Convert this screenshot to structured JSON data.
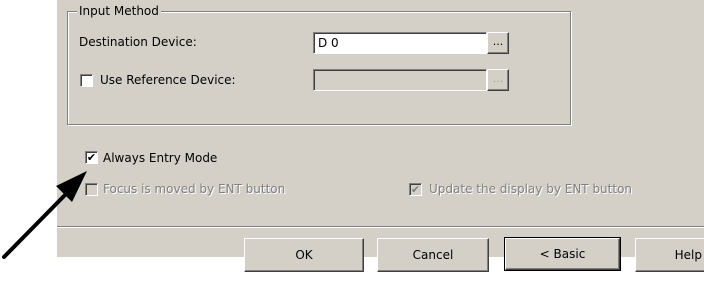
{
  "input_method": {
    "title": "Input Method",
    "destination_label": "Destination Device:",
    "destination_value": "D 0",
    "browse_label": "...",
    "use_reference_label": "Use Reference  Device:",
    "use_reference_checked": false,
    "reference_value": "",
    "reference_browse_label": "..."
  },
  "options": {
    "always_entry_label": "Always Entry Mode",
    "always_entry_checked": true,
    "focus_moved_label": "Focus is moved by ENT button",
    "update_display_label": "Update the display by ENT button",
    "update_display_checked": true
  },
  "buttons": {
    "ok": "OK",
    "cancel": "Cancel",
    "basic": "< Basic",
    "help": "Help"
  },
  "annotation": {
    "arrow_color": "#000000"
  }
}
